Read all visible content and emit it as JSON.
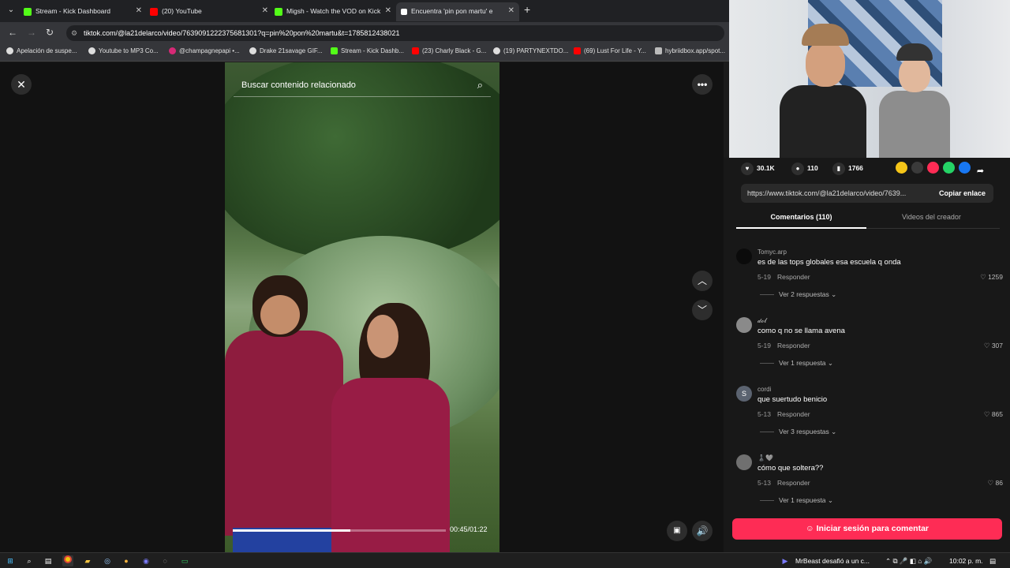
{
  "tabs": [
    {
      "title": "Stream - Kick Dashboard",
      "color": "#53fc18"
    },
    {
      "title": "(20) YouTube",
      "color": "#ff0000"
    },
    {
      "title": "Migsh - Watch the VOD on Kick",
      "color": "#53fc18"
    },
    {
      "title": "Encuentra 'pin pon martu' e",
      "color": "#ffffff"
    }
  ],
  "address": {
    "url": "tiktok.com/@la21delarco/video/7639091222375681301?q=pin%20pon%20martu&t=1785812438021"
  },
  "bookmarks": [
    "Apelación de suspe...",
    "Youtube to MP3 Co...",
    "@champagnepapi •...",
    "Drake 21savage GIF...",
    "Stream - Kick Dashb...",
    "(23) Charly Black - G...",
    "(19) PARTYNEXTDO...",
    "(69) Lust For Life - Y...",
    "hybriidbox.app/spot..."
  ],
  "video": {
    "search_placeholder": "Buscar contenido relacionado",
    "time": "00:45/01:22",
    "progress": 0.55
  },
  "stats": {
    "likes": "30.1K",
    "comments": "110",
    "saves": "1766"
  },
  "share": {
    "link": "https://www.tiktok.com/@la21delarco/video/7639...",
    "copy_label": "Copiar enlace"
  },
  "panel_tabs": {
    "comments": "Comentarios (110)",
    "creator": "Videos del creador"
  },
  "comments": [
    {
      "user": "Tomyc.arp",
      "text": "es de las tops globales esa escuela q onda",
      "date": "5-19",
      "reply": "Responder",
      "likes": "1259",
      "view": "Ver 2 respuestas",
      "avatar": "#0b0b0b"
    },
    {
      "user": "𝓭𝓸𝓵",
      "text": "como q no se llama avena",
      "date": "5-19",
      "reply": "Responder",
      "likes": "307",
      "view": "Ver 1 respuesta",
      "avatar": "#8a8a8a"
    },
    {
      "user": "cordi",
      "text": "que suertudo benicio",
      "date": "5-13",
      "reply": "Responder",
      "likes": "865",
      "view": "Ver 3 respuestas",
      "avatar": "#5b6370"
    },
    {
      "user": "♟️🩶",
      "text": "cómo que soltera??",
      "date": "5-13",
      "reply": "Responder",
      "likes": "86",
      "view": "Ver 1 respuesta",
      "avatar": "#707070"
    }
  ],
  "login_label": "Iniciar sesión para comentar",
  "taskbar": {
    "notification": "MrBeast desafió a un c...",
    "clock": "10:02 p. m."
  }
}
